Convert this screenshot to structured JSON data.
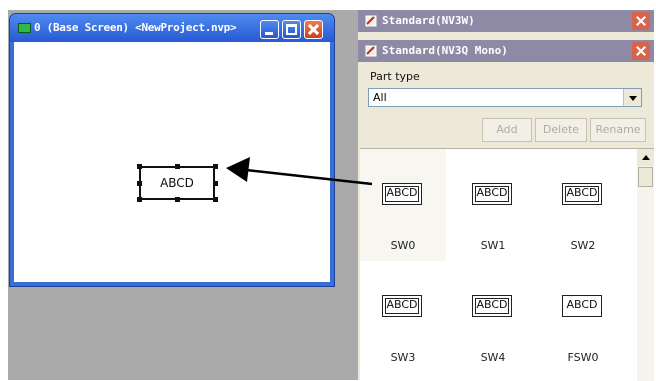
{
  "editor_window": {
    "title": "0 (Base Screen) <NewProject.nvp>",
    "part_text": "ABCD"
  },
  "panel_standard_nv3w": {
    "title": "Standard(NV3W)"
  },
  "panel_standard_nv3q": {
    "title": "Standard(NV3Q Mono)",
    "part_type_label": "Part type",
    "part_type_value": "All",
    "buttons": {
      "add": "Add",
      "delete": "Delete",
      "rename": "Rename"
    },
    "parts": [
      {
        "button_text": "ABCD",
        "label": "SW0"
      },
      {
        "button_text": "ABCD",
        "label": "SW1"
      },
      {
        "button_text": "ABCD",
        "label": "SW2"
      },
      {
        "button_text": "ABCD",
        "label": "SW3"
      },
      {
        "button_text": "ABCD",
        "label": "SW4"
      },
      {
        "button_text": "ABCD",
        "label": "FSW0"
      }
    ]
  },
  "colors": {
    "title_bar_blue": "#2759d4",
    "panel_title": "#8e8aa6",
    "close_red": "#d9644c"
  }
}
